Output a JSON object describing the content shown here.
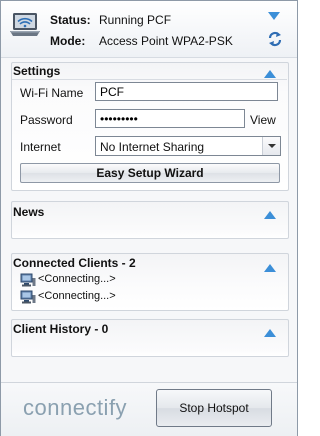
{
  "header": {
    "status_label": "Status:",
    "status_value": "Running PCF",
    "mode_label": "Mode:",
    "mode_value": "Access Point WPA2-PSK"
  },
  "settings": {
    "title": "Settings",
    "wifi_name_label": "Wi-Fi Name",
    "wifi_name_value": "PCF",
    "password_label": "Password",
    "password_value": "•••••••••",
    "view_label": "View",
    "internet_label": "Internet",
    "internet_value": "No Internet Sharing",
    "wizard_label": "Easy Setup Wizard"
  },
  "news": {
    "title": "News"
  },
  "clients": {
    "title": "Connected Clients - 2",
    "items": [
      "<Connecting...>",
      "<Connecting...>"
    ]
  },
  "history": {
    "title": "Client History - 0"
  },
  "footer": {
    "logo": "connectify",
    "stop_label": "Stop Hotspot"
  },
  "colors": {
    "accent": "#3c8fd8",
    "border": "#d0d5dc"
  }
}
